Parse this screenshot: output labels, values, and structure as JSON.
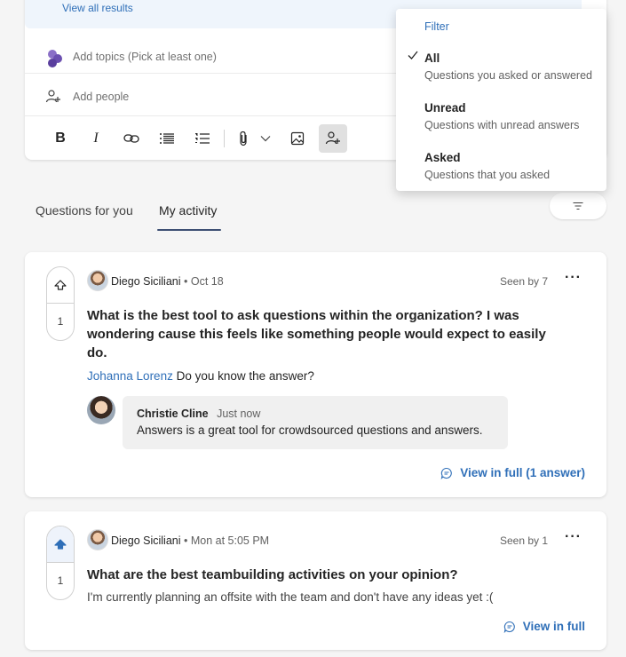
{
  "composer": {
    "view_all_results": "View all results",
    "topics_placeholder": "Add topics (Pick at least one)",
    "people_placeholder": "Add people",
    "toolbar": {
      "bold": "B",
      "italic": "I"
    }
  },
  "filter_menu": {
    "title": "Filter",
    "options": [
      {
        "title": "All",
        "desc": "Questions you asked or answered",
        "selected": true
      },
      {
        "title": "Unread",
        "desc": "Questions with unread answers",
        "selected": false
      },
      {
        "title": "Asked",
        "desc": "Questions that you asked",
        "selected": false
      }
    ]
  },
  "tabs": [
    {
      "label": "Questions for you",
      "active": false
    },
    {
      "label": "My activity",
      "active": true
    }
  ],
  "questions": [
    {
      "votes": "1",
      "voted": false,
      "author": "Diego Siciliani",
      "date": "Oct 18",
      "seen": "Seen by 7",
      "title_lines": [
        "What is the best tool to ask questions within the organization? I was",
        "wondering cause this feels like something people would expect to easily",
        "do."
      ],
      "mention_name": "Johanna Lorenz",
      "mention_text": "Do you know the answer?",
      "answer": {
        "name": "Christie Cline",
        "time": "Just now",
        "text": "Answers is a great tool for crowdsourced questions and answers."
      },
      "view_full": "View in full (1 answer)"
    },
    {
      "votes": "1",
      "voted": true,
      "author": "Diego Siciliani",
      "date": "Mon at 5:05 PM",
      "seen": "Seen by 1",
      "title": "What are the best teambuilding activities on your opinion?",
      "body": "I'm currently planning an offsite with the team and don't have any ideas yet :(",
      "view_full": "View in full"
    }
  ],
  "colors": {
    "accent": "#2f6fb8",
    "tab_underline": "#3d4f73",
    "vote_active": "#2f6fb8"
  },
  "icons": [
    "topics-icon",
    "add-people-icon",
    "bold-icon",
    "italic-icon",
    "link-icon",
    "bulleted-list-icon",
    "numbered-list-icon",
    "attach-icon",
    "chevron-down-icon",
    "image-icon",
    "mention-people-icon",
    "filter-icon",
    "upvote-icon",
    "more-icon",
    "comment-icon",
    "checkmark-icon"
  ]
}
